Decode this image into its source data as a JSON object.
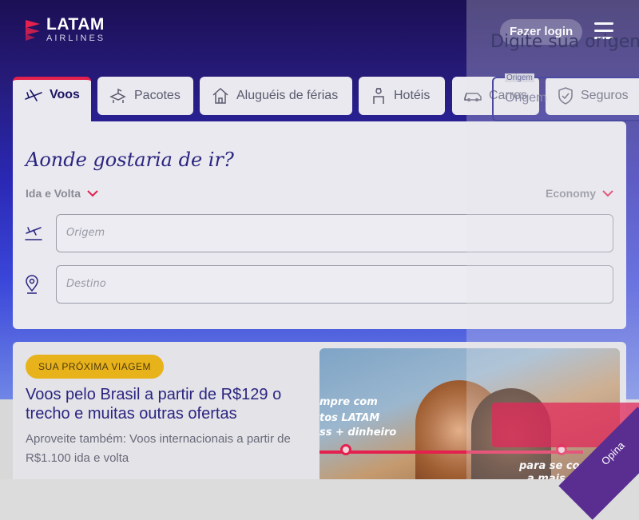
{
  "header": {
    "logo_name": "LATAM",
    "logo_sub": "AIRLINES",
    "login_label": "Fazer login",
    "menu_icon": "hamburger-menu-icon"
  },
  "tabs": [
    {
      "label": "Voos",
      "icon": "airplane-icon",
      "active": true
    },
    {
      "label": "Pacotes",
      "icon": "package-icon",
      "active": false
    },
    {
      "label": "Aluguéis de férias",
      "icon": "house-icon",
      "active": false
    },
    {
      "label": "Hotéis",
      "icon": "hotel-bellboy-icon",
      "active": false
    },
    {
      "label": "Carros",
      "icon": "car-icon",
      "active": false
    },
    {
      "label": "Seguros",
      "icon": "shield-icon",
      "active": false
    }
  ],
  "search": {
    "title": "Aonde gostaria de ir?",
    "trip_type": "Ida e Volta",
    "cabin": "Economy",
    "origin_placeholder": "Origem",
    "destination_placeholder": "Destino"
  },
  "promo": {
    "badge": "SUA PRÓXIMA VIAGEM",
    "title": "Voos pelo Brasil a partir de R$129 o trecho e muitas outras ofertas",
    "subtitle": "Aproveite também: Voos internacionais a partir de R$1.100 ida e volta",
    "image_text_1": "mpre com",
    "image_text_2": "tos LATAM",
    "image_text_3": "ss + dinheiro",
    "image_text_4": "para se conect",
    "image_text_5": "a mais de"
  },
  "overlay": {
    "title": "Digite sua origem",
    "field_label": "Origem",
    "field_placeholder": "Origem"
  },
  "feedback": {
    "label": "Opina"
  },
  "colors": {
    "brand_indigo": "#1b1464",
    "accent_red": "#e3204e",
    "badge_yellow": "#e8b21a",
    "feedback_purple": "#5a2d91"
  }
}
